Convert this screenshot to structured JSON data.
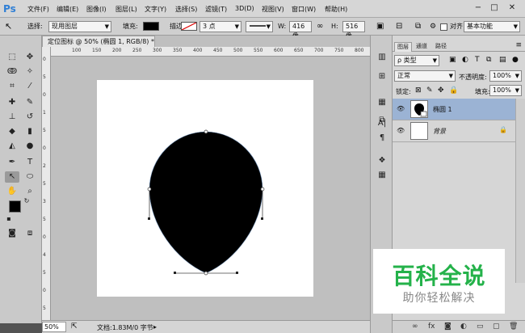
{
  "app": {
    "logo": "Ps"
  },
  "menu": [
    "文件(F)",
    "编辑(E)",
    "图像(I)",
    "图层(L)",
    "文字(Y)",
    "选择(S)",
    "滤镜(T)",
    "3D(D)",
    "视图(V)",
    "窗口(W)",
    "帮助(H)"
  ],
  "window_controls": {
    "minimize": "−",
    "restore": "□",
    "close": "✕"
  },
  "options": {
    "select_label": "选择:",
    "select_value": "现用图层",
    "fill_label": "填充:",
    "stroke_label": "描边:",
    "stroke_size": "3 点",
    "w_label": "W:",
    "w_value": "416 像",
    "h_label": "H:",
    "h_value": "516 像",
    "align_label": "对齐",
    "workspace": "基本功能"
  },
  "document": {
    "tab_title": "定位图标 @ 50% (椭圆 1, RGB/8) *",
    "tab_close": "×",
    "ruler_ticks": [
      "100",
      "150",
      "200",
      "250",
      "300",
      "350",
      "400",
      "450",
      "500",
      "550",
      "600",
      "650",
      "700",
      "750",
      "800"
    ],
    "ruler_v_ticks": [
      "0",
      "5",
      "0",
      "1",
      "5",
      "0",
      "2",
      "5",
      "3",
      "5",
      "0",
      "4",
      "5",
      "0",
      "5"
    ]
  },
  "status": {
    "zoom": "50%",
    "doc_size": "文档:1.83M/0 字节",
    "arrow": "▸"
  },
  "layers_panel": {
    "tabs": [
      "图层",
      "通道",
      "路径"
    ],
    "filter_kind": "ρ 类型",
    "blend_mode": "正常",
    "opacity_label": "不透明度:",
    "opacity_value": "100%",
    "lock_label": "锁定:",
    "fill_label": "填充:",
    "fill_value": "100%",
    "layers": [
      {
        "name": "椭圆 1",
        "active": true
      },
      {
        "name": "背景",
        "active": false,
        "locked": true
      }
    ],
    "bottom_icons": [
      "link-icon",
      "fx-icon",
      "mask-icon",
      "adjustment-icon",
      "group-icon",
      "new-layer-icon",
      "trash-icon"
    ]
  },
  "watermark": {
    "main": "百科全说",
    "sub": "助你轻松解决"
  },
  "colors": {
    "accent": "#2f7fd5",
    "watermark_green": "#24b24a",
    "active_layer": "#9bb3d4"
  }
}
